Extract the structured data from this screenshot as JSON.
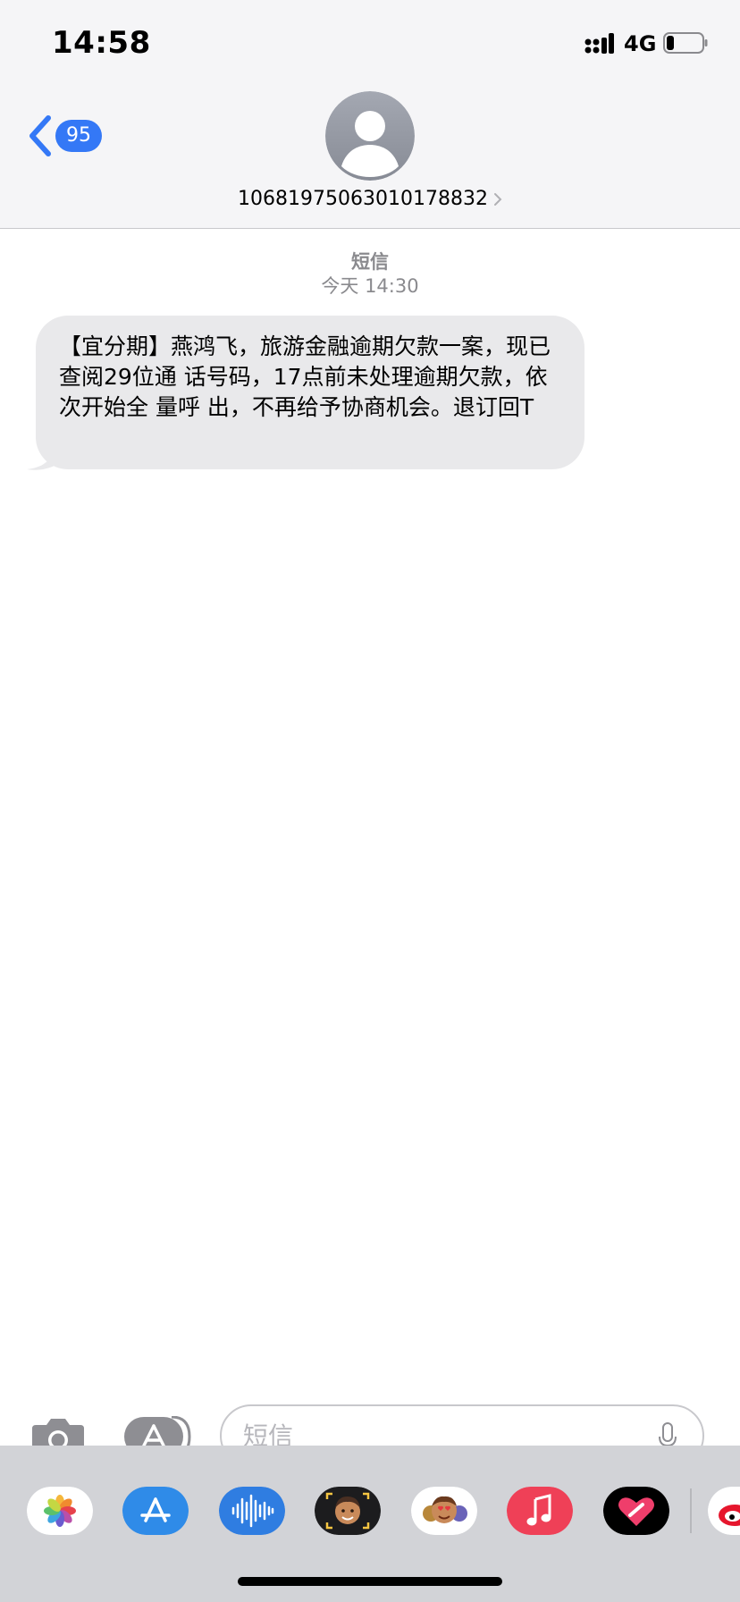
{
  "status_bar": {
    "time": "14:58",
    "network": "4G",
    "battery_level": 0.2
  },
  "nav": {
    "back_count": "95",
    "contact_number": "10681975063010178832"
  },
  "thread": {
    "label": "短信",
    "timestamp": "今天 14:30",
    "messages": [
      {
        "direction": "incoming",
        "text": "【宜分期】燕鸿飞，旅游金融逾期欠款一案，现已查阅29位通 话号码，17点前未处理逾期欠款，依次开始全 量呼 出，不再给予协商机会。退订回T"
      }
    ]
  },
  "compose": {
    "placeholder": "短信"
  },
  "app_drawer": {
    "apps": [
      "photos-app-icon",
      "app-store-icon",
      "audio-message-icon",
      "memoji-icon",
      "animoji-icon",
      "music-app-icon",
      "digital-touch-icon",
      "weibo-app-icon"
    ]
  },
  "colors": {
    "accent": "#3478f6",
    "bubble_incoming": "#e9e9eb",
    "header_bg": "#f5f5f7",
    "drawer_bg": "#d2d3d7"
  }
}
